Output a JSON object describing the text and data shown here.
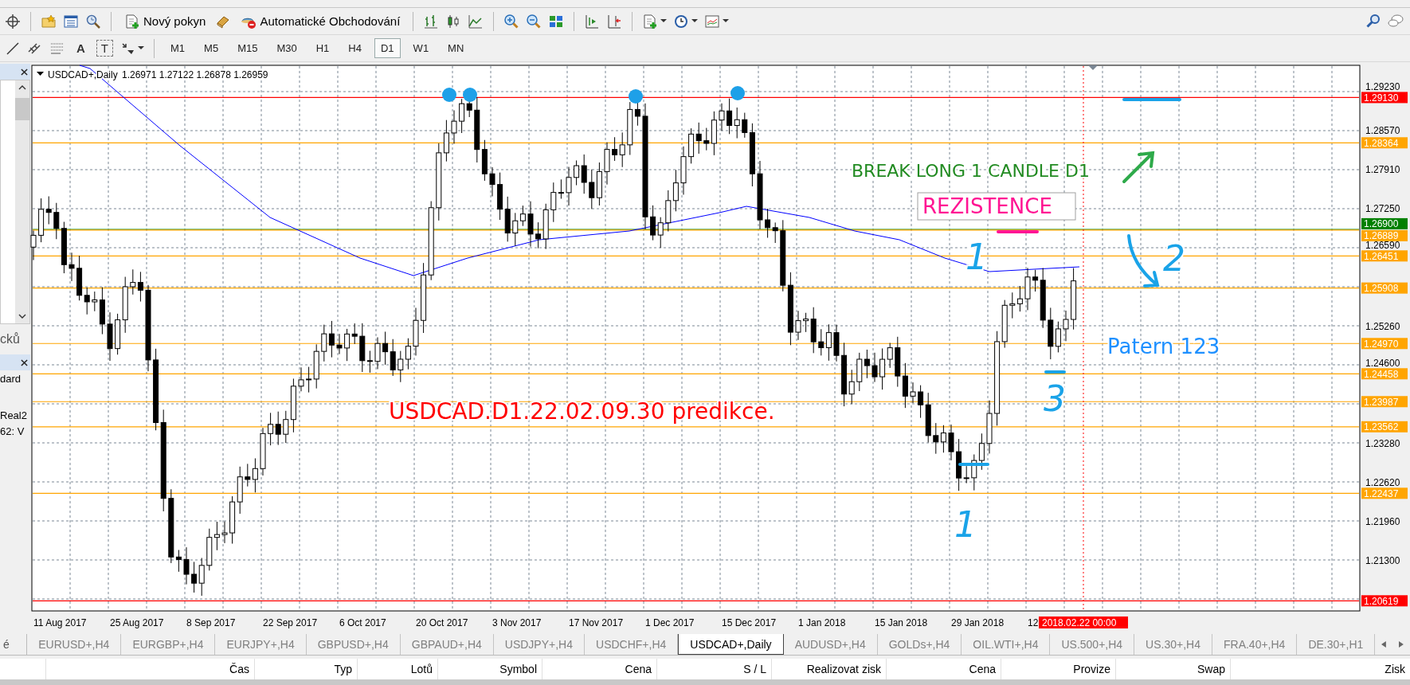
{
  "toolbar": {
    "buttons": [
      "Nový pokyn",
      "Automatické Obchodování"
    ],
    "drawing_tools": [
      "A",
      "T"
    ],
    "timeframes": [
      {
        "label": "M1",
        "selected": false
      },
      {
        "label": "M5",
        "selected": false
      },
      {
        "label": "M15",
        "selected": false
      },
      {
        "label": "M30",
        "selected": false
      },
      {
        "label": "H1",
        "selected": false
      },
      {
        "label": "H4",
        "selected": false
      },
      {
        "label": "D1",
        "selected": true
      },
      {
        "label": "W1",
        "selected": false
      },
      {
        "label": "MN",
        "selected": false
      }
    ]
  },
  "left_panel": {
    "texts": [
      "cků",
      "dard",
      "Real2",
      "62: V"
    ]
  },
  "chart": {
    "title": "USDCAD+,Daily",
    "quote": "1.26971 1.27122 1.26878 1.26959",
    "price_ticks": [
      "1.29230",
      "1.28570",
      "1.27910",
      "1.27250",
      "1.26590",
      "1.25260",
      "1.24600",
      "1.23280",
      "1.22620",
      "1.21960",
      "1.21300"
    ],
    "levels": [
      {
        "price": "1.29130",
        "color": "#ff0000"
      },
      {
        "price": "1.28364",
        "color": "#ffa500"
      },
      {
        "price": "1.26900",
        "color": "#008000"
      },
      {
        "price": "1.26889",
        "color": "#ffa500"
      },
      {
        "price": "1.26451",
        "color": "#ffa500"
      },
      {
        "price": "1.25908",
        "color": "#ffa500"
      },
      {
        "price": "1.24970",
        "color": "#ffa500"
      },
      {
        "price": "1.24458",
        "color": "#ffa500"
      },
      {
        "price": "1.23987",
        "color": "#ffa500"
      },
      {
        "price": "1.23562",
        "color": "#ffa500"
      },
      {
        "price": "1.22437",
        "color": "#ffa500"
      },
      {
        "price": "1.20619",
        "color": "#ff0000"
      }
    ],
    "dates": [
      "11 Aug 2017",
      "25 Aug 2017",
      "8 Sep 2017",
      "22 Sep 2017",
      "6 Oct 2017",
      "20 Oct 2017",
      "3 Nov 2017",
      "17 Nov 2017",
      "1 Dec 2017",
      "15 Dec 2017",
      "1 Jan 2018",
      "15 Jan 2018",
      "29 Jan 2018",
      "12"
    ],
    "cursor_date": "2018.02.22 00:00",
    "annotations": [
      {
        "kind": "text",
        "text": "BREAK  LONG 1 CANDLE D1",
        "color": "#228b22"
      },
      {
        "kind": "boxed",
        "text": "REZISTENCE",
        "color": "#ff1493"
      },
      {
        "kind": "text",
        "text": "Patern 123",
        "color": "#1e90ff"
      },
      {
        "kind": "text",
        "text": "USDCAD.D1.22.02.09.30 predikce.",
        "color": "#ff0000"
      },
      {
        "kind": "hand",
        "text": "1",
        "color": "#1aa3e8"
      },
      {
        "kind": "hand",
        "text": "1",
        "color": "#1aa3e8"
      },
      {
        "kind": "hand",
        "text": "3",
        "color": "#1aa3e8"
      },
      {
        "kind": "hand",
        "text": "2",
        "color": "#1aa3e8"
      }
    ]
  },
  "tabs_fragment": "é",
  "tabs": [
    {
      "label": "EURUSD+,H4",
      "selected": false
    },
    {
      "label": "EURGBP+,H4",
      "selected": false
    },
    {
      "label": "EURJPY+,H4",
      "selected": false
    },
    {
      "label": "GBPUSD+,H4",
      "selected": false
    },
    {
      "label": "GBPAUD+,H4",
      "selected": false
    },
    {
      "label": "USDJPY+,H4",
      "selected": false
    },
    {
      "label": "USDCHF+,H4",
      "selected": false
    },
    {
      "label": "USDCAD+,Daily",
      "selected": true
    },
    {
      "label": "AUDUSD+,H4",
      "selected": false
    },
    {
      "label": "GOLDs+,H4",
      "selected": false
    },
    {
      "label": "OIL.WTI+,H4",
      "selected": false
    },
    {
      "label": "US.500+,H4",
      "selected": false
    },
    {
      "label": "US.30+,H4",
      "selected": false
    },
    {
      "label": "FRA.40+,H4",
      "selected": false
    },
    {
      "label": "DE.30+,H1",
      "selected": false
    }
  ],
  "table": {
    "columns": [
      "Čas",
      "Typ",
      "Lotů",
      "Symbol",
      "Cena",
      "S / L",
      "Realizovat zisk",
      "Cena",
      "Provize",
      "Swap",
      "Zisk"
    ]
  }
}
